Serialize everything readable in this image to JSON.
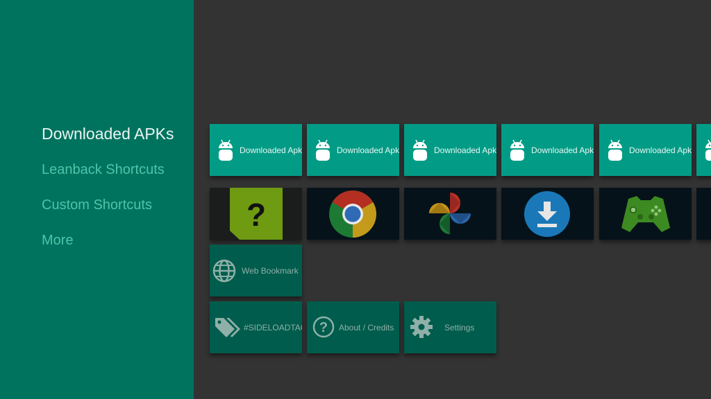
{
  "sidebar": {
    "items": [
      {
        "label": "Downloaded APKs",
        "active": true
      },
      {
        "label": "Leanback Shortcuts"
      },
      {
        "label": "Custom Shortcuts"
      },
      {
        "label": "More"
      }
    ]
  },
  "apk_row": {
    "label": "Downloaded Apk",
    "icon": "android-robot-icon"
  },
  "leanback_row": [
    {
      "icon": "help-tag-icon"
    },
    {
      "icon": "chrome-icon"
    },
    {
      "icon": "pinwheel-icon"
    },
    {
      "icon": "download-icon"
    },
    {
      "icon": "gamepad-icon"
    }
  ],
  "custom_row": {
    "web_bookmark": "Web Bookmark"
  },
  "more_row": {
    "sideloadtags": "#SIDELOADTAGS",
    "about": "About / Credits",
    "settings": "Settings"
  },
  "colors": {
    "sidebar_bg": "#00735f",
    "content_bg": "#333333",
    "apk_card": "#029c86",
    "util_card": "#005c4c",
    "active_text": "#e9f5f1",
    "inactive_text": "#4fc4a8"
  }
}
